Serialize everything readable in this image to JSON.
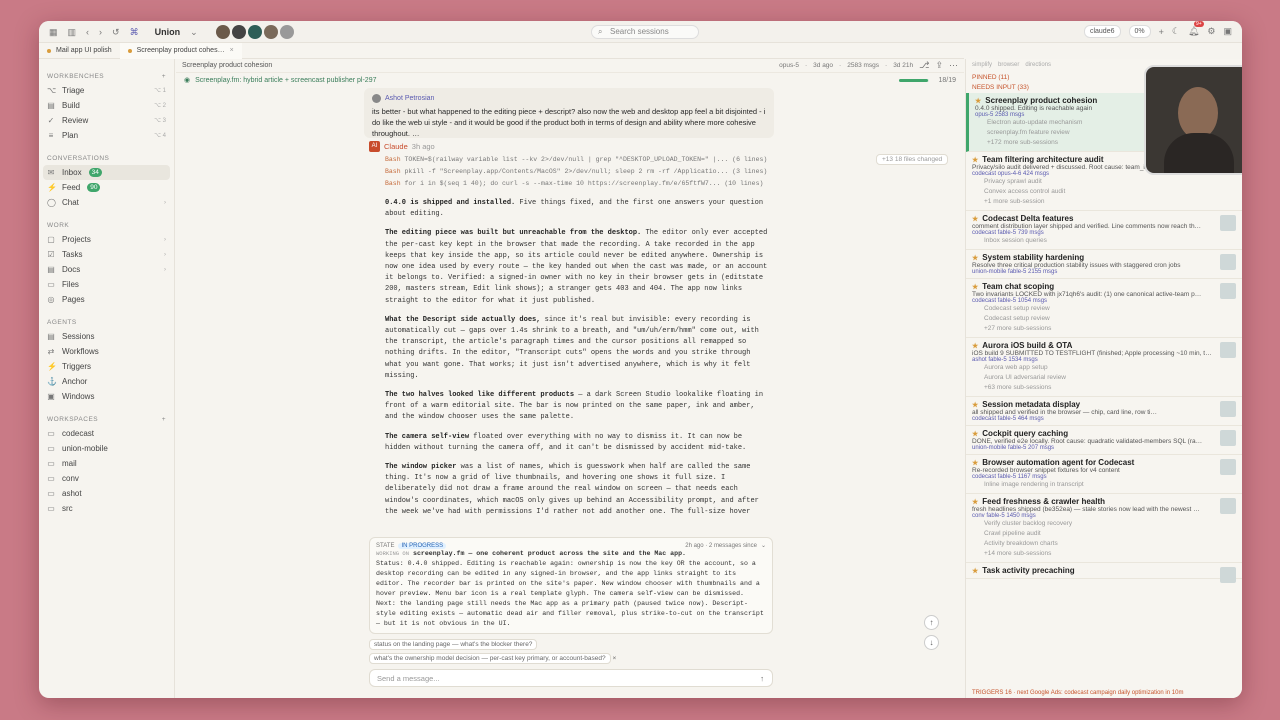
{
  "titlebar": {
    "workspace": "Union",
    "search_placeholder": "Search sessions",
    "right_user": "claude6",
    "right_pct": "0%",
    "notif_count": "9+"
  },
  "tabs": [
    {
      "label": "Mail app UI polish"
    },
    {
      "label": "Screenplay product cohes…",
      "close": "×"
    }
  ],
  "sidebar": {
    "workbenches_label": "WORKBENCHES",
    "workbenches": [
      {
        "icon": "⌥",
        "label": "Triage"
      },
      {
        "icon": "▤",
        "label": "Build"
      },
      {
        "icon": "✓",
        "label": "Review"
      },
      {
        "icon": "≡",
        "label": "Plan"
      }
    ],
    "conversations_label": "CONVERSATIONS",
    "conversations": [
      {
        "icon": "✉",
        "label": "Inbox",
        "badge": "34"
      },
      {
        "icon": "⚡",
        "label": "Feed",
        "badge": "90"
      },
      {
        "icon": "◯",
        "label": "Chat"
      }
    ],
    "work_label": "WORK",
    "work": [
      "Projects",
      "Tasks",
      "Docs",
      "Files",
      "Pages"
    ],
    "agents_label": "AGENTS",
    "agents": [
      "Sessions",
      "Workflows",
      "Triggers",
      "Anchor",
      "Windows"
    ],
    "workspaces_label": "WORKSPACES",
    "workspaces": [
      "codecast",
      "union-mobile",
      "mail",
      "conv",
      "ashot",
      "src"
    ]
  },
  "main": {
    "header_title": "Screenplay product cohesion",
    "header_meta": [
      "opus-5",
      "3d ago",
      "2583 msgs",
      "3d 21h"
    ],
    "crumb": "Screenplay.fm: hybrid article + screencast publisher pl-297",
    "progress_label": "18/19",
    "progress_value": 0.95,
    "user_name": "Ashot Petrosian",
    "user_msg": "its better - but what happened to the editing piece + descript? also now the web and desktop app feel a bit disjointed - i do like the web ui style - and it would be good if the product both in terms of design and ability where more cohesive throughout. …",
    "assistant_name": "Claude",
    "assistant_time": "3h ago",
    "files_changed": "+13 18 files changed",
    "bash": [
      "TOKEN=$(railway variable list --kv 2>/dev/null | grep \"^DESKTOP_UPLOAD_TOKEN=\" |... (6 lines)",
      "pkill -f \"Screenplay.app/Contents/MacOS\" 2>/dev/null; sleep 2 rm -rf /Applicatio... (3 lines)",
      "for i in $(seq 1 40); do curl -s --max-time 10 https://screenplay.fm/e/65ftfW7... (10 lines)"
    ],
    "paragraphs": [
      {
        "bold": "0.4.0 is shipped and installed.",
        "text": " Five things fixed, and the first one answers your question about editing."
      },
      {
        "bold": "The editing piece was built but unreachable from the desktop.",
        "text": " The editor only ever accepted the per-cast key kept in the browser that made the recording. A take recorded in the app keeps that key inside the app, so its article could never be edited anywhere. Ownership is now one idea used by every route — the key handed out when the cast was made, or an account it belongs to. Verified: a signed-in owner with no key in their browser gets in (editstate 200, masters stream, Edit link shows); a stranger gets 403 and 404. The app now links straight to the editor for what it just published."
      },
      {
        "bold": "What the Descript side actually does,",
        "text": " since it's real but invisible: every recording is automatically cut — gaps over 1.4s shrink to a breath, and \"um/uh/erm/hmm\" come out, with the transcript, the article's paragraph times and the cursor positions all remapped so nothing drifts. In the editor, \"Transcript cuts\" opens the words and you strike through what you want gone. That works; it just isn't advertised anywhere, which is why it felt missing."
      },
      {
        "bold": "The two halves looked like different products",
        "text": " — a dark Screen Studio lookalike floating in front of a warm editorial site. The bar is now printed on the same paper, ink and amber, and the window chooser uses the same palette."
      },
      {
        "bold": "The camera self-view",
        "text": " floated over everything with no way to dismiss it. It can now be hidden without turning the camera off, and it can't be dismissed by accident mid-take."
      },
      {
        "bold": "The window picker",
        "text": " was a list of names, which is guesswork when half are called the same thing. It's now a grid of live thumbnails, and hovering one shows it full size. I deliberately did not draw a frame around the real window on screen — that needs each window's coordinates, which macOS only gives up behind an Accessibility prompt, and after the week we've had with permissions I'd rather not add another one. The full-size hover answers the same question. Also: when the grid is"
      }
    ],
    "state": {
      "label": "STATE",
      "badge": "IN PROGRESS",
      "working_on": "WORKING ON",
      "headline": "screenplay.fm — one coherent product across the site and the Mac app.",
      "time": "2h ago · 2 messages since",
      "status": "Status: 0.4.0 shipped. Editing is reachable again: ownership is now the key OR the account, so a desktop recording can be edited in any signed-in browser, and the app links straight to its editor. The recorder bar is printed on the site's paper. New window chooser with thumbnails and a hover preview. Menu bar icon is a real template glyph. The camera self-view can be dismissed.",
      "next": "Next: the landing page still needs the Mac app as a primary path (paused twice now). Descript-style editing exists — automatic dead air and filler removal, plus strike-to-cut on the transcript — but it is not obvious in the UI."
    },
    "chips": [
      "status on the landing page — what's the blocker there?",
      "what's the ownership model decision — per-cast key primary, or account-based?"
    ],
    "composer_placeholder": "Send a message..."
  },
  "rpanel": {
    "tabs": [
      "simplify",
      "browser",
      "directions"
    ],
    "pinned_label": "PINNED (11)",
    "needs_input_label": "NEEDS INPUT (33)",
    "items": [
      {
        "title": "Screenplay product cohesion",
        "sub": "0.4.0 shipped. Editing is reachable again",
        "meta": "opus-5 2583 msgs",
        "sel": true,
        "children": [
          "Electron auto-update mechanism",
          "screenplay.fm feature review",
          "+172 more sub-sessions"
        ]
      },
      {
        "title": "Team filtering architecture audit",
        "sub": "Privacy/silo audit delivered + discussed. Root cause: team_id overloaded (r…",
        "meta": "codecast  opus-4-6  424 msgs",
        "children": [
          "Privacy sprawl audit",
          "Convex access control audit",
          "+1 more sub-session"
        ]
      },
      {
        "title": "Codecast Delta features",
        "sub": "comment distribution layer shipped and verified. Line comments now reach th…",
        "meta": "codecast  fable-5  739 msgs",
        "children": [
          "Inbox session queries"
        ]
      },
      {
        "title": "System stability hardening",
        "sub": "Resolve three critical production stability issues with staggered cron jobs",
        "meta": "union-mobile  fable-5  2155 msgs",
        "children": []
      },
      {
        "title": "Team chat scoping",
        "sub": "Two invariants LOCKED with jx71qh6's audit: (1) one canonical active-team p…",
        "meta": "codecast  fable-5  1054 msgs",
        "children": [
          "Codecast setup review",
          "Codecast setup review",
          "+27 more sub-sessions"
        ]
      },
      {
        "title": "Aurora iOS build & OTA",
        "sub": "iOS build 9 SUBMITTED TO TESTFLIGHT (finished; Apple processing ~10 min, th…",
        "meta": "ashot  fable-5  1534 msgs",
        "children": [
          "Aurora web app setup",
          "Aurora UI adversarial review",
          "+63 more sub-sessions"
        ]
      },
      {
        "title": "Session metadata display",
        "sub": "all shipped and verified in the browser — chip, card line, row ti…",
        "meta": "codecast  fable-5  464 msgs",
        "children": []
      },
      {
        "title": "Cockpit query caching",
        "sub": "DONE, verified e2e locally. Root cause: quadratic validated-members SQL (ra…",
        "meta": "union-mobile  fable-5  207 msgs",
        "children": []
      },
      {
        "title": "Browser automation agent for Codecast",
        "sub": "Re-recorded browser snippet fixtures for v4 content",
        "meta": "codecast  fable-5  1167 msgs",
        "children": [
          "Inline image rendering in transcript"
        ]
      },
      {
        "title": "Feed freshness & crawler health",
        "sub": "fresh headlines shipped (be352ea) — stale stories now lead with the newest …",
        "meta": "conv  fable-5  1450 msgs",
        "children": [
          "Verify cluster backlog recovery",
          "Crawl pipeline audit",
          "Activity breakdown charts",
          "+14 more sub-sessions"
        ]
      },
      {
        "title": "Task activity precaching",
        "sub": "",
        "meta": "",
        "children": []
      }
    ],
    "triggers": "TRIGGERS 16 · next Google Ads: codecast campaign daily optimization in 10m"
  }
}
